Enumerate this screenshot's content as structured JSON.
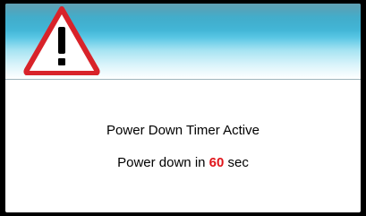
{
  "dialog": {
    "icon": "warning-icon",
    "title": "Power Down Timer Active",
    "countdown_prefix": "Power down in",
    "countdown_value": "60",
    "countdown_suffix": "sec",
    "accent_color": "#e0141a",
    "header_color": "#1c9cc0"
  }
}
